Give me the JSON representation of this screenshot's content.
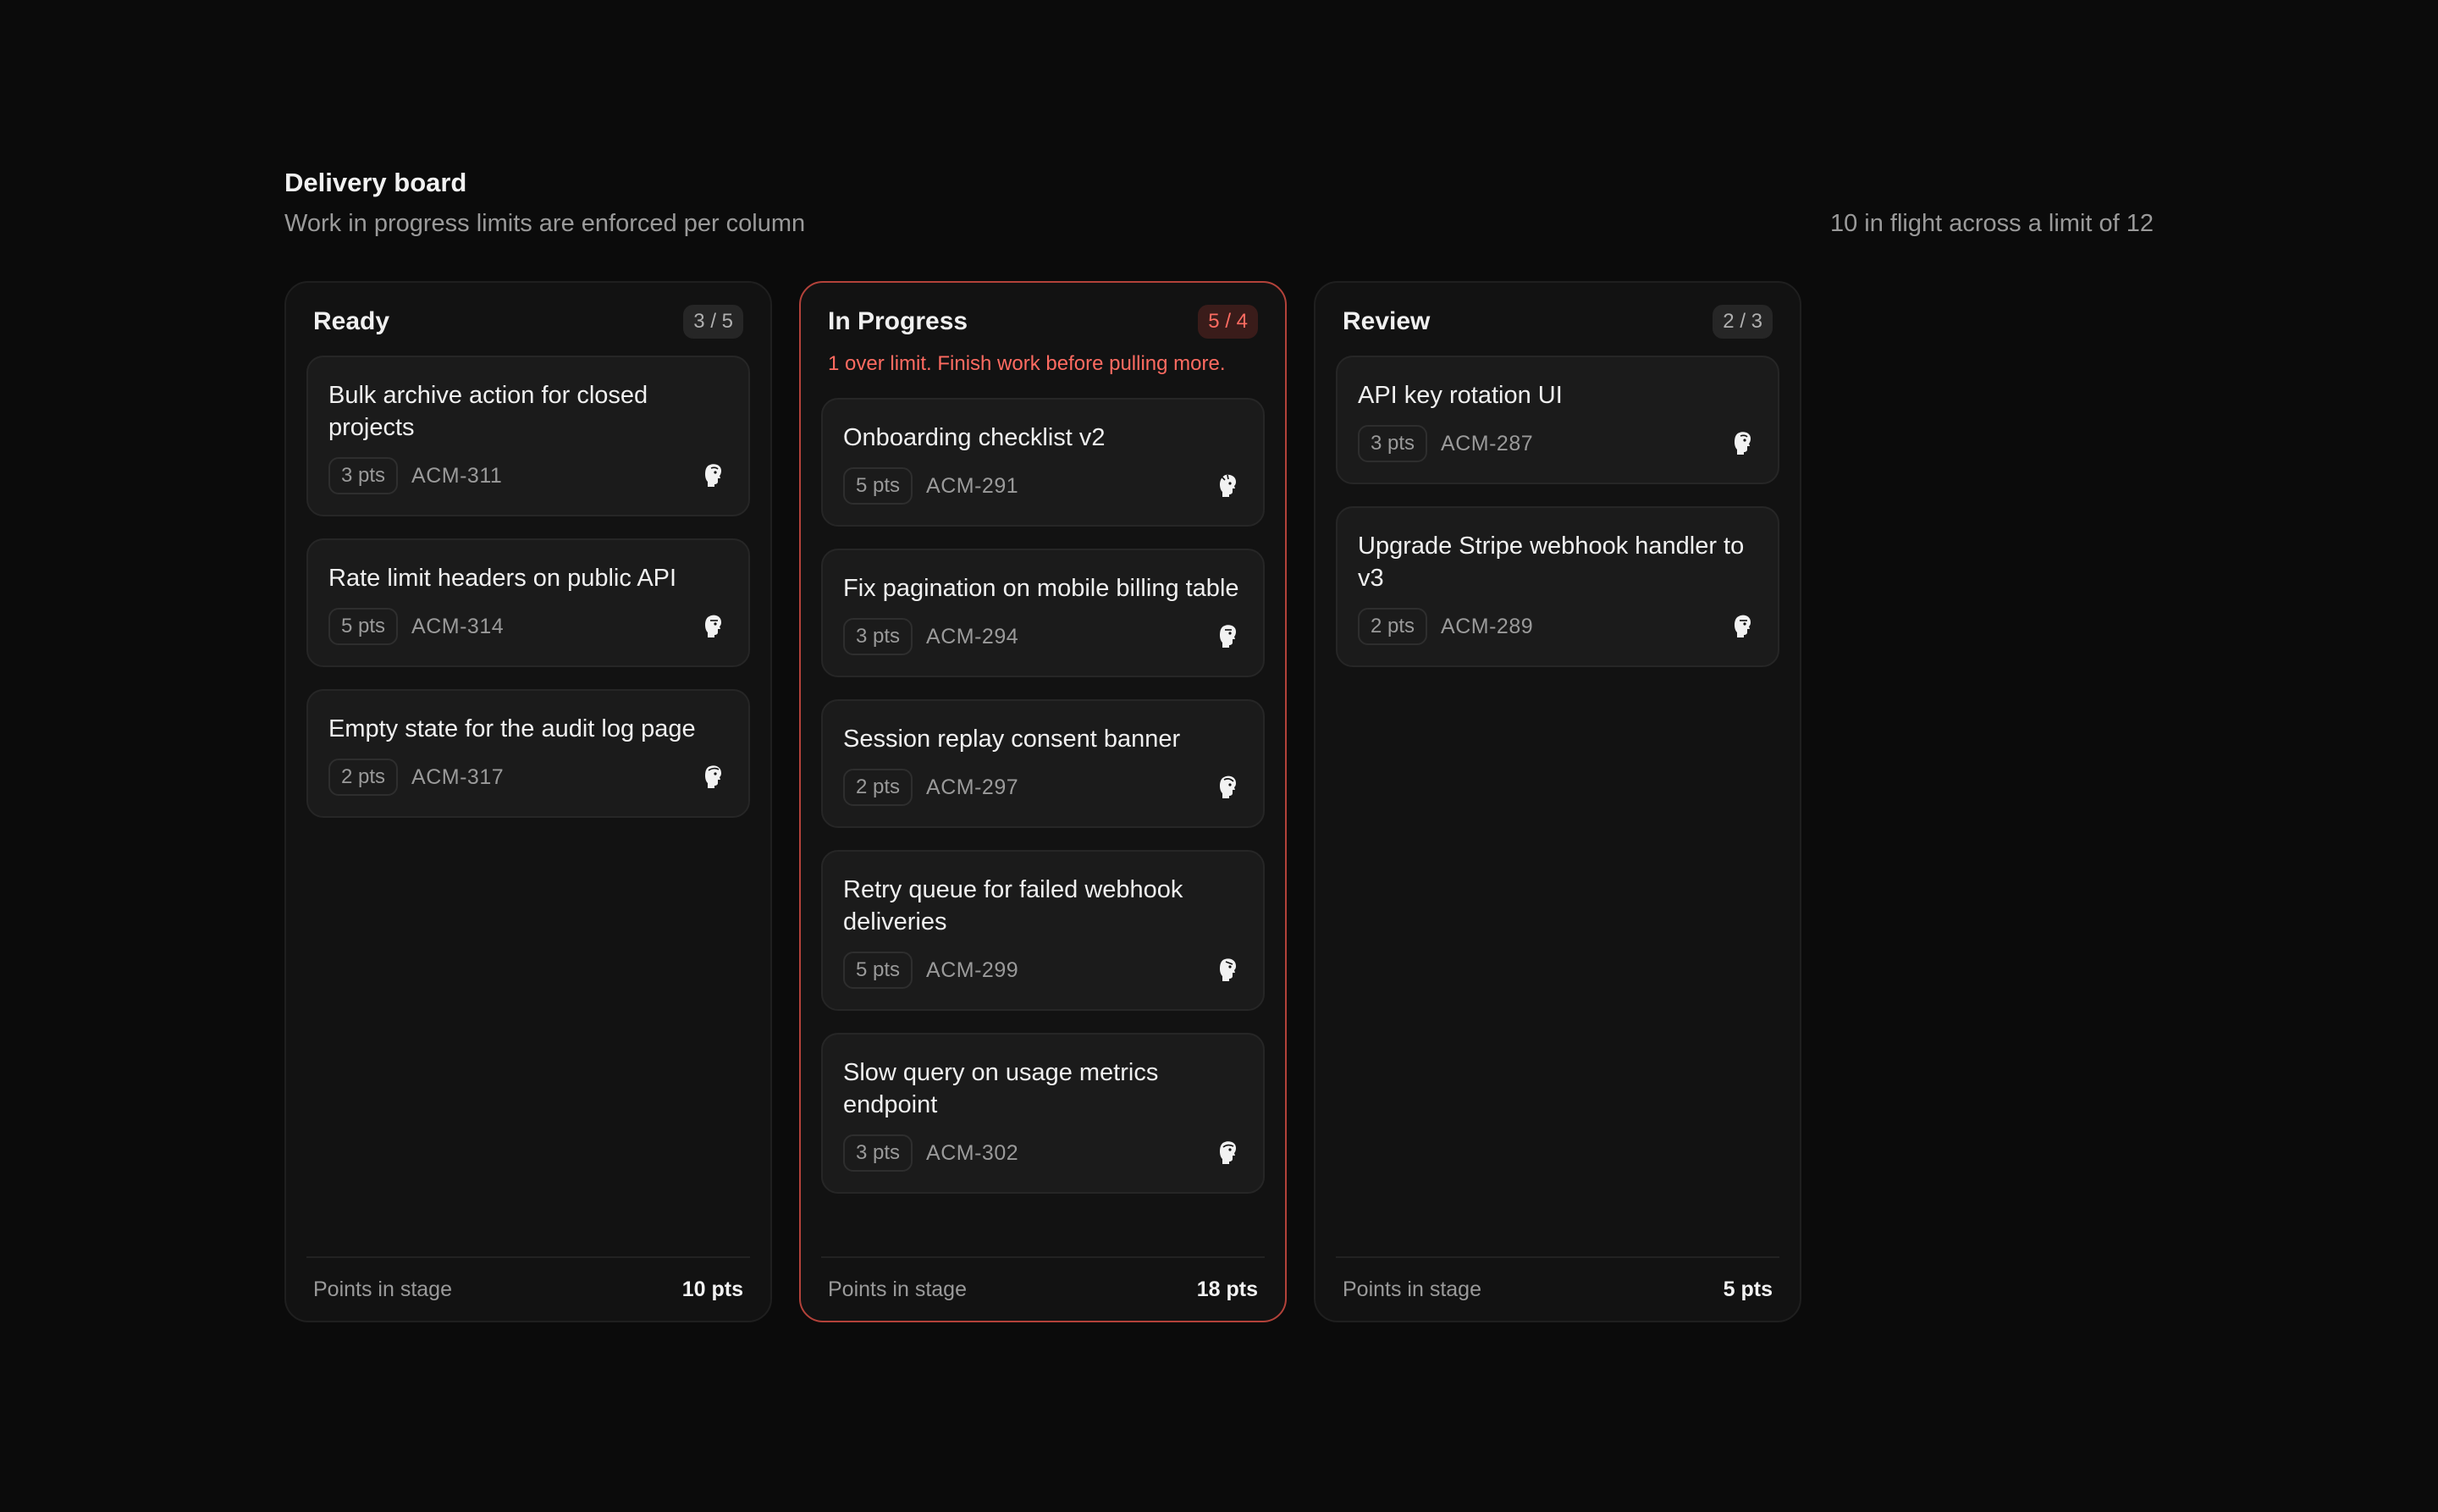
{
  "header": {
    "title": "Delivery board",
    "subtitle": "Work in progress limits are enforced per column",
    "summary": "10 in flight across a limit of 12"
  },
  "columns": [
    {
      "title": "Ready",
      "wip": "3 / 5",
      "over_limit": false,
      "warning": "",
      "footer_label": "Points in stage",
      "footer_value": "10 pts",
      "cards": [
        {
          "title": "Bulk archive action for closed projects",
          "points": "3 pts",
          "key": "ACM-311",
          "avatar_icon": "avatar-icon"
        },
        {
          "title": "Rate limit headers on public API",
          "points": "5 pts",
          "key": "ACM-314",
          "avatar_icon": "avatar-icon"
        },
        {
          "title": "Empty state for the audit log page",
          "points": "2 pts",
          "key": "ACM-317",
          "avatar_icon": "avatar-icon"
        }
      ]
    },
    {
      "title": "In Progress",
      "wip": "5 / 4",
      "over_limit": true,
      "warning": "1 over limit. Finish work before pulling more.",
      "footer_label": "Points in stage",
      "footer_value": "18 pts",
      "cards": [
        {
          "title": "Onboarding checklist v2",
          "points": "5 pts",
          "key": "ACM-291",
          "avatar_icon": "avatar-icon"
        },
        {
          "title": "Fix pagination on mobile billing table",
          "points": "3 pts",
          "key": "ACM-294",
          "avatar_icon": "avatar-icon"
        },
        {
          "title": "Session replay consent banner",
          "points": "2 pts",
          "key": "ACM-297",
          "avatar_icon": "avatar-icon"
        },
        {
          "title": "Retry queue for failed webhook deliveries",
          "points": "5 pts",
          "key": "ACM-299",
          "avatar_icon": "avatar-icon"
        },
        {
          "title": "Slow query on usage metrics endpoint",
          "points": "3 pts",
          "key": "ACM-302",
          "avatar_icon": "avatar-icon"
        }
      ]
    },
    {
      "title": "Review",
      "wip": "2 / 3",
      "over_limit": false,
      "warning": "",
      "footer_label": "Points in stage",
      "footer_value": "5 pts",
      "cards": [
        {
          "title": "API key rotation UI",
          "points": "3 pts",
          "key": "ACM-287",
          "avatar_icon": "avatar-icon"
        },
        {
          "title": "Upgrade Stripe webhook handler to v3",
          "points": "2 pts",
          "key": "ACM-289",
          "avatar_icon": "avatar-icon"
        }
      ]
    }
  ],
  "colors": {
    "background": "#0b0b0b",
    "column": "#121212",
    "card": "#1b1b1b",
    "danger": "#ff6b61",
    "danger_border": "#b3423a"
  }
}
